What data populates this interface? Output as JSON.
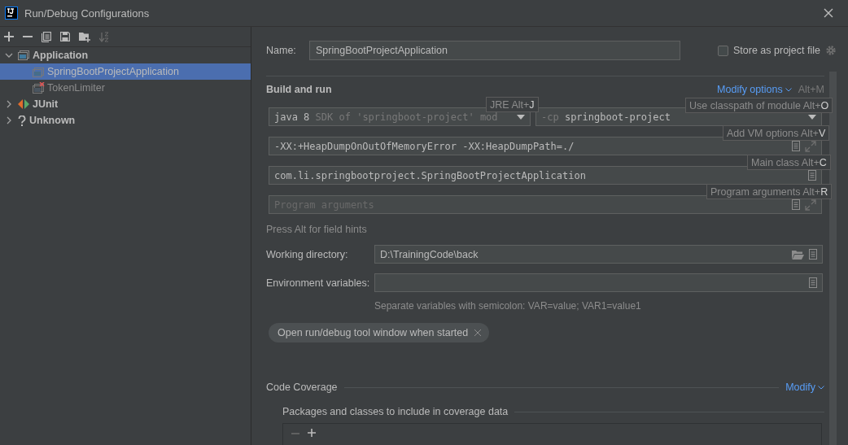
{
  "window": {
    "title": "Run/Debug Configurations"
  },
  "tree": [
    {
      "label": "Application",
      "kind": "application",
      "expanded": true,
      "selected": false,
      "children": [
        {
          "label": "SpringBootProjectApplication",
          "selected": true,
          "error": false
        },
        {
          "label": "TokenLimiter",
          "selected": false,
          "error": true
        }
      ]
    },
    {
      "label": "JUnit",
      "kind": "junit",
      "expanded": false,
      "selected": false
    },
    {
      "label": "Unknown",
      "kind": "unknown",
      "expanded": false,
      "selected": false
    }
  ],
  "name_field": {
    "label": "Name:",
    "value": "SpringBootProjectApplication"
  },
  "store_as_project_file": {
    "label": "Store as project file",
    "checked": false
  },
  "build_and_run": {
    "title": "Build and run",
    "modify_options": "Modify options",
    "modify_shortcut": "Alt+M",
    "jre": {
      "value": "java 8",
      "hint": "SDK of 'springboot-project' mod"
    },
    "classpath": {
      "prefix": "-cp",
      "value": "springboot-project"
    },
    "vm_options": {
      "value": "-XX:+HeapDumpOnOutOfMemoryError -XX:HeapDumpPath=./"
    },
    "main_class": {
      "value": "com.li.springbootproject.SpringBootProjectApplication"
    },
    "program_arguments": {
      "placeholder": "Program arguments"
    }
  },
  "field_hints": [
    {
      "kind": "jre",
      "text": "JRE Alt+",
      "key": "J"
    },
    {
      "kind": "classpath",
      "text": "Use classpath of module Alt+",
      "key": "O"
    },
    {
      "kind": "vm",
      "text": "Add VM options Alt+",
      "key": "V"
    },
    {
      "kind": "main",
      "text": "Main class Alt+",
      "key": "C"
    },
    {
      "kind": "args",
      "text": "Program arguments Alt+",
      "key": "R"
    }
  ],
  "press_alt_hint": "Press Alt for field hints",
  "working_directory": {
    "label": "Working directory:",
    "value": "D:\\TrainingCode\\back"
  },
  "environment_variables": {
    "label": "Environment variables:",
    "note": "Separate variables with semicolon: VAR=value; VAR1=value1"
  },
  "option_chip": "Open run/debug tool window when started",
  "code_coverage": {
    "title": "Code Coverage",
    "modify": "Modify",
    "packages_label": "Packages and classes to include in coverage data"
  }
}
